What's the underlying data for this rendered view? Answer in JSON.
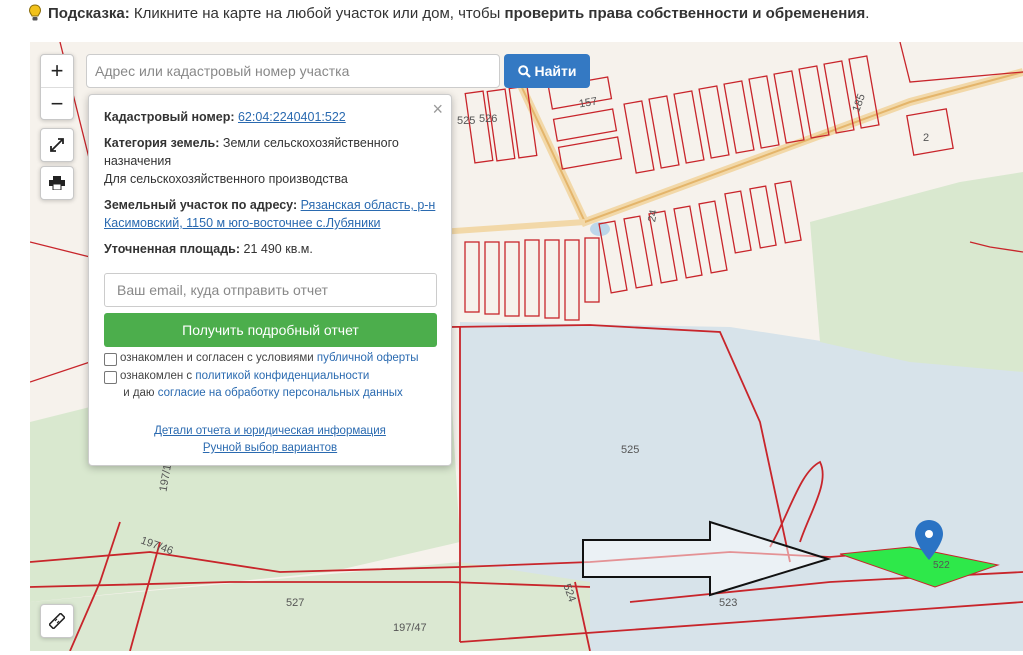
{
  "hint": {
    "label": "Подсказка:",
    "text": " Кликните на карте на любой участок или дом, чтобы ",
    "strong": "проверить права собственности и обременения",
    "end": "."
  },
  "search": {
    "placeholder": "Адрес или кадастровый номер участка",
    "button": "Найти"
  },
  "zoom": {
    "in": "+",
    "out": "−"
  },
  "popup": {
    "cadastral_label": "Кадастровый номер:",
    "cadastral_value": "62:04:2240401:522",
    "category_label": "Категория земель:",
    "category_value": "Земли сельскохозяйственного назначения",
    "usage": "Для сельскохозяйственного производства",
    "address_label": "Земельный участок по адресу:",
    "address_value": "Рязанская область, р-н Касимовский, 1150 м юго-восточнее с.Лубяники",
    "area_label": "Уточненная площадь:",
    "area_value": "21 490 кв.м.",
    "email_placeholder": "Ваш email, куда отправить отчет",
    "report_button": "Получить подробный отчет",
    "consent1_pre": "ознакомлен и согласен с условиями ",
    "consent1_link": "публичной оферты",
    "consent2_pre": "ознакомлен с ",
    "consent2_link": "политикой конфиденциальности",
    "consent2_mid": " и даю ",
    "consent2_link2": "согласие на обработку персональных данных",
    "details_link": "Детали отчета и юридическая информация",
    "manual_link": "Ручной выбор вариантов"
  },
  "map_labels": {
    "l157": "157",
    "l185": "185",
    "l2": "2",
    "l525a": "525",
    "l526": "526",
    "l24": "24",
    "l525": "525",
    "l522": "522",
    "l523": "523",
    "l524": "524",
    "l527": "527",
    "l197_46": "197/46",
    "l197_47": "197/47",
    "l197_1": "197/1"
  },
  "colors": {
    "boundary": "#c8252b",
    "forest": "#d8e8cf",
    "water": "#d6e2ea",
    "selected": "#2ee84a",
    "button_blue": "#3479c3",
    "button_green": "#4cae4c"
  }
}
